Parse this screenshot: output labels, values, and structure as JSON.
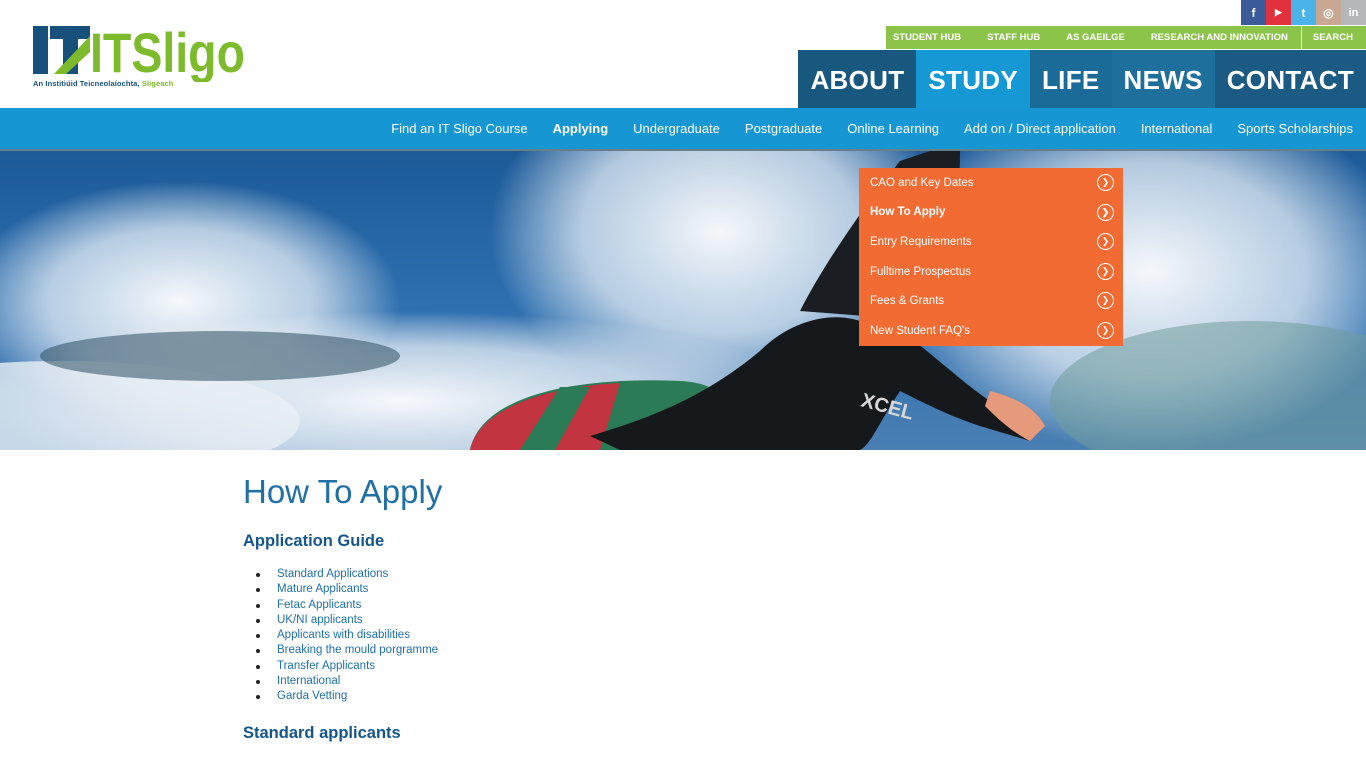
{
  "logo": {
    "text": "ITSligo",
    "tagline_main": "An Institiúid Teicneolaíochta, ",
    "tagline_accent": "Sligeach"
  },
  "social": [
    {
      "name": "facebook-icon",
      "glyph": "f",
      "color": "#3b5a9a"
    },
    {
      "name": "youtube-icon",
      "glyph": "▶",
      "color": "#e0313c"
    },
    {
      "name": "twitter-icon",
      "glyph": "t",
      "color": "#4bb3ea"
    },
    {
      "name": "instagram-icon",
      "glyph": "◎",
      "color": "#c8a892"
    },
    {
      "name": "linkedin-icon",
      "glyph": "in",
      "color": "#b5b8ba"
    }
  ],
  "utility_nav": [
    "STUDENT HUB",
    "STAFF HUB",
    "AS GAEILGE",
    "RESEARCH AND INNOVATION",
    "SEARCH"
  ],
  "main_nav": [
    "ABOUT",
    "STUDY",
    "LIFE",
    "NEWS",
    "CONTACT"
  ],
  "sub_nav": [
    "Find an IT Sligo Course",
    "Applying",
    "Undergraduate",
    "Postgraduate",
    "Online Learning",
    "Add on / Direct application",
    "International",
    "Sports Scholarships"
  ],
  "dropdown": [
    "CAO and Key Dates",
    "How To Apply",
    "Entry Requirements",
    "Fulltime Prospectus",
    "Fees & Grants",
    "New Student FAQ's"
  ],
  "hero": {
    "board_text": "XCEL"
  },
  "content": {
    "title": "How To Apply",
    "guide_heading": "Application Guide",
    "guide_items": [
      "Standard Applications",
      "Mature Applicants",
      "Fetac Applicants",
      "UK/NI applicants",
      "Applicants with disabilities",
      "Breaking the mould porgramme",
      "Transfer Applicants",
      "International",
      "Garda Vetting"
    ],
    "standard_heading": "Standard applicants"
  }
}
